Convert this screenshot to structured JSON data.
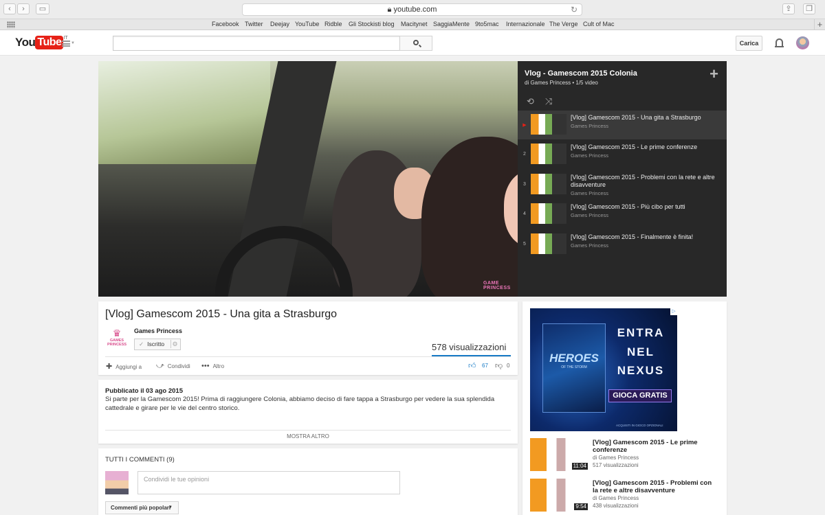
{
  "browser": {
    "url": "youtube.com",
    "bookmarks": [
      "Facebook",
      "Twitter",
      "Deejay",
      "YouTube",
      "Ridble",
      "Gli Stockisti blog",
      "Macitynet",
      "SaggiaMente",
      "9to5mac",
      "Internazionale",
      "The Verge",
      "Cult of Mac"
    ]
  },
  "header": {
    "logo_you": "You",
    "logo_tube": "Tube",
    "logo_region": "IT",
    "upload_label": "Carica"
  },
  "playlist": {
    "title": "Vlog - Gamescom 2015 Colonia",
    "meta": "di Games Princess • 1/5 video",
    "items": [
      {
        "index": "▶",
        "title": "[Vlog] Gamescom 2015 - Una gita a Strasburgo",
        "owner": "Games Princess"
      },
      {
        "index": "2",
        "title": "[Vlog] Gamescom 2015 - Le prime conferenze",
        "owner": "Games Princess"
      },
      {
        "index": "3",
        "title": "[Vlog] Gamescom 2015 - Problemi con la rete e altre disavventure",
        "owner": "Games Princess"
      },
      {
        "index": "4",
        "title": "[Vlog] Gamescom 2015 - Più cibo per tutti",
        "owner": "Games Princess"
      },
      {
        "index": "5",
        "title": "[Vlog] Gamescom 2015 - Finalmente è finita!",
        "owner": "Games Princess"
      }
    ]
  },
  "player": {
    "watermark": "GAME PRINCESS"
  },
  "video": {
    "title": "[Vlog] Gamescom 2015 - Una gita a Strasburgo",
    "channel": "Games Princess",
    "channel_logo_text": "GAMES PRINCESS",
    "subscribe_label": "Iscritto",
    "views": "578 visualizzazioni",
    "add_to": "Aggiungi a",
    "share": "Condividi",
    "more": "Altro",
    "likes": "67",
    "dislikes": "0"
  },
  "description": {
    "published": "Pubblicato il 03 ago 2015",
    "text": "Si parte per la Gamescom 2015! Prima di raggiungere Colonia, abbiamo deciso di fare tappa a Strasburgo per vedere la sua splendida cattedrale e girare per le vie del centro storico.",
    "show_more": "MOSTRA ALTRO"
  },
  "comments": {
    "header": "TUTTI I COMMENTI (9)",
    "placeholder": "Condividi le tue opinioni",
    "sort_label": "Commenti più popolari"
  },
  "ad": {
    "product": "HEROES",
    "product_sub": "OF THE STORM",
    "line1": "ENTRA",
    "line2": "NEL",
    "line3": "NEXUS",
    "cta": "GIOCA GRATIS",
    "footer": "ACQUISTI IN GIOCO OPZIONALI"
  },
  "related": [
    {
      "title": "[Vlog] Gamescom 2015 - Le prime conferenze",
      "owner": "di Games Princess",
      "views": "517 visualizzazioni",
      "duration": "11:04"
    },
    {
      "title": "[Vlog] Gamescom 2015 - Problemi con la rete e altre disavventure",
      "owner": "di Games Princess",
      "views": "438 visualizzazioni",
      "duration": "9:54"
    }
  ]
}
